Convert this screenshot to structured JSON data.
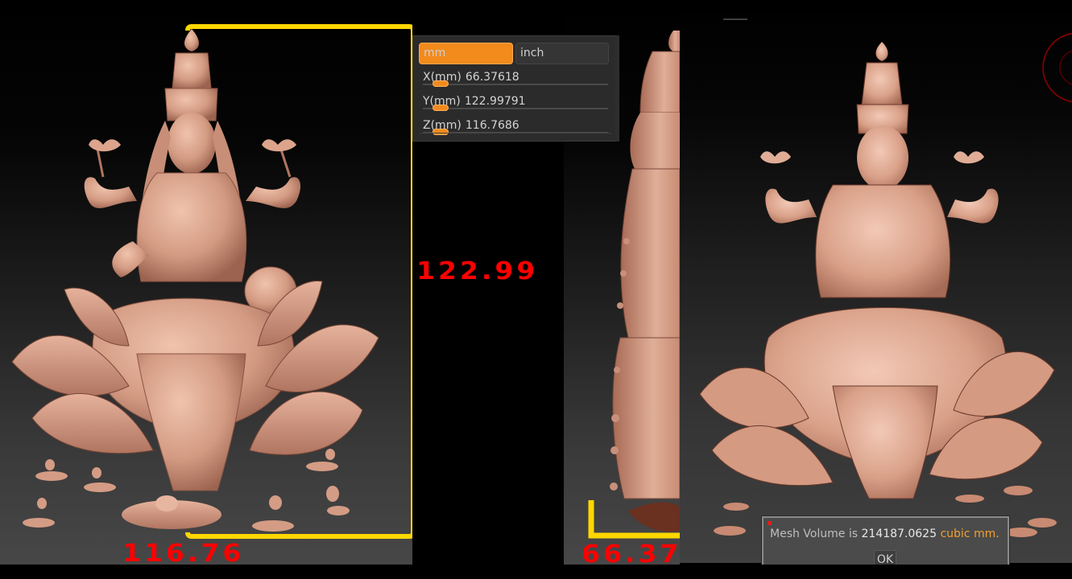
{
  "unit_panel": {
    "units": [
      {
        "label": "mm",
        "selected": true
      },
      {
        "label": "inch",
        "selected": false
      }
    ],
    "sliders": [
      {
        "axis_label": "X(mm)",
        "value": "66.37618",
        "fill": 0.05
      },
      {
        "axis_label": "Y(mm)",
        "value": "122.99791",
        "fill": 0.05
      },
      {
        "axis_label": "Z(mm)",
        "value": "116.7686",
        "fill": 0.05
      }
    ]
  },
  "dimensions": {
    "height_label": "122.99",
    "width_label": "116.76",
    "depth_label": "66.37"
  },
  "dialog": {
    "prefix": "Mesh Volume is",
    "value": "214187.0625",
    "unit": "cubic mm.",
    "ok_label": "OK"
  },
  "colors": {
    "accent": "#f28a1c",
    "dimension_bracket": "#ffd700",
    "dimension_text": "#ff0000",
    "model_tint": "#d9a088",
    "gizmo": "#8b0000"
  },
  "views": [
    {
      "name": "front-view"
    },
    {
      "name": "side-view"
    },
    {
      "name": "relief-view"
    }
  ]
}
